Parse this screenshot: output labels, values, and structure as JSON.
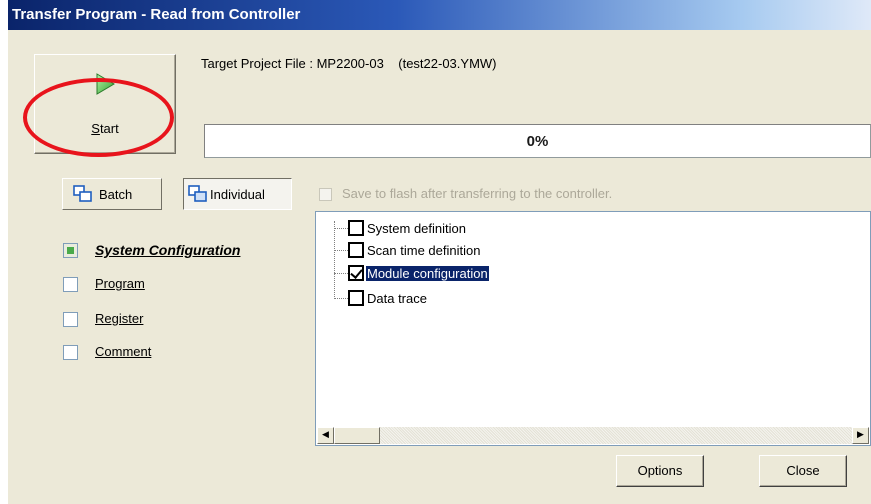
{
  "window": {
    "title": "Transfer Program - Read from Controller"
  },
  "start_button": {
    "label": "Start",
    "mnemonic": "S",
    "rest": "tart",
    "icon": "play-icon"
  },
  "target": {
    "text": "Target Project File : MP2200-03    (test22-03.YMW)"
  },
  "progress": {
    "percent": 0,
    "label": "0%"
  },
  "modes": {
    "batch_label": "Batch",
    "individual_label": "Individual",
    "selected": "Individual"
  },
  "flash": {
    "label": "Save to flash after transferring to the controller.",
    "checked": false,
    "enabled": false
  },
  "categories": [
    {
      "label": "System Configuration",
      "selected": true
    },
    {
      "label": "Program",
      "selected": false
    },
    {
      "label": "Register",
      "selected": false
    },
    {
      "label": "Comment",
      "selected": false
    }
  ],
  "tree": [
    {
      "label": "System definition",
      "checked": false,
      "selected": false
    },
    {
      "label": "Scan time definition",
      "checked": false,
      "selected": false
    },
    {
      "label": "Module configuration",
      "checked": true,
      "selected": true
    },
    {
      "label": "Data trace",
      "checked": false,
      "selected": false
    }
  ],
  "buttons": {
    "options_label": "Options",
    "close_label": "Close"
  },
  "colors": {
    "highlight": "#0a246a",
    "annotation_circle": "#e8141c",
    "titlebar": "#0a246a"
  }
}
